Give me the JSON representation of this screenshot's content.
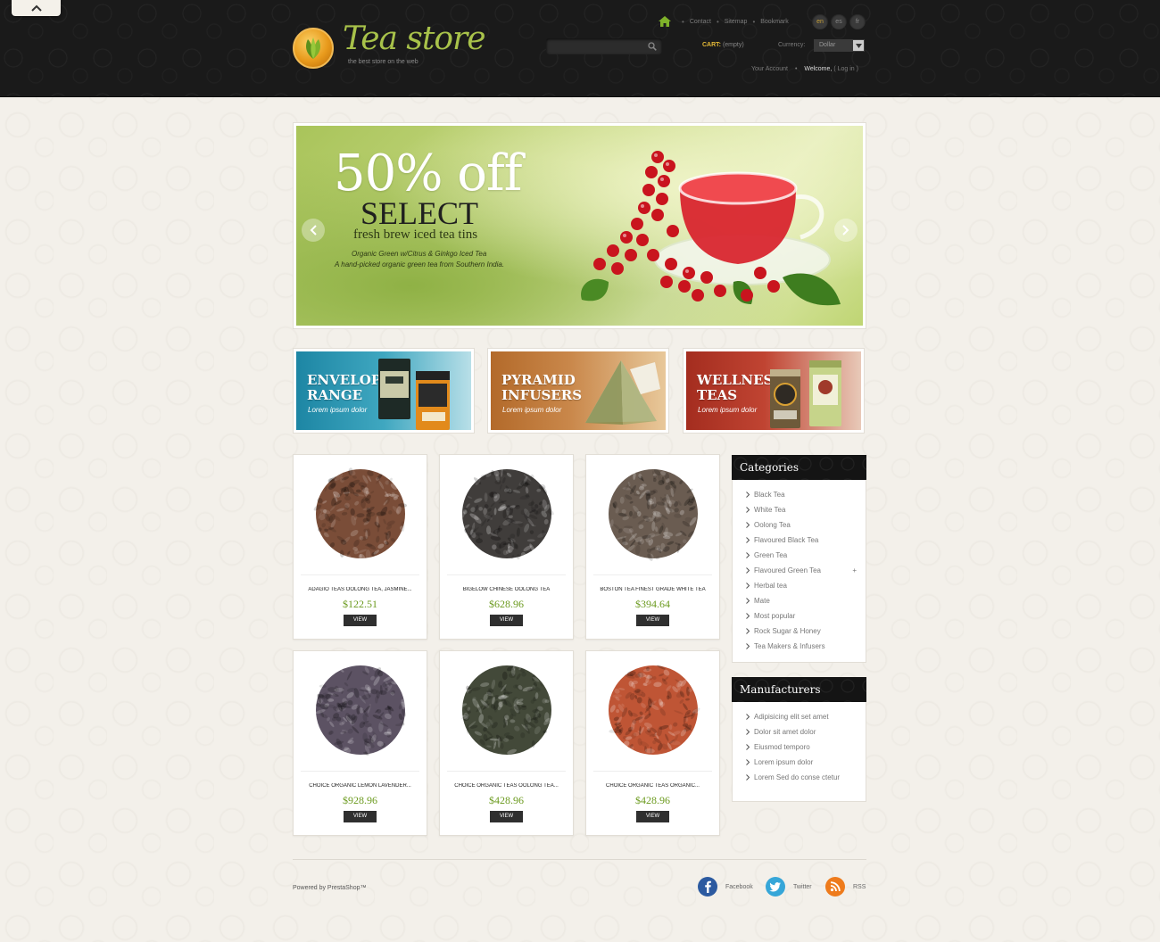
{
  "header": {
    "logo_title": "Tea store",
    "logo_tagline": "the best store on the web",
    "top_links": [
      "Contact",
      "Sitemap",
      "Bookmark"
    ],
    "languages": [
      {
        "code": "en",
        "active": true
      },
      {
        "code": "es",
        "active": false
      },
      {
        "code": "fr",
        "active": false
      }
    ],
    "search_placeholder": "",
    "cart_label": "CART:",
    "cart_status": "(empty)",
    "currency_label": "Currency:",
    "currency_value": "Dollar",
    "account_link": "Your Account",
    "welcome": "Welcome,",
    "login": "( Log in )"
  },
  "slider": {
    "headline": "50% off",
    "subheadline": "SELECT",
    "line": "fresh brew iced tea tins",
    "desc1": "Organic Green w/Citrus & Ginkgo Iced Tea",
    "desc2": "A hand-picked organic green tea from Southern India."
  },
  "banners": [
    {
      "title": "ENVELOPE RANGE",
      "subtitle": "Lorem ipsum  dolor"
    },
    {
      "title": "PYRAMID INFUSERS",
      "subtitle": "Lorem ipsum  dolor"
    },
    {
      "title": "WELLNESS TEAS",
      "subtitle": "Lorem ipsum  dolor"
    }
  ],
  "products": [
    {
      "name": "ADAGIO TEAS OOLONG TEA, JASMINE...",
      "price": "$122.51",
      "button": "VIEW",
      "color": "#6b3a22"
    },
    {
      "name": "BIGELOW CHINESE OOLONG TEA",
      "price": "$628.96",
      "button": "VIEW",
      "color": "#2b2826"
    },
    {
      "name": "BOSTON TEA FINEST GRADE WHITE TEA",
      "price": "$394.64",
      "button": "VIEW",
      "color": "#5a4a3e"
    },
    {
      "name": "CHOICE ORGANIC LEMON LAVENDER...",
      "price": "$928.96",
      "button": "VIEW",
      "color": "#4a3f52"
    },
    {
      "name": "CHOICE ORGANIC TEAS OOLONG TEA...",
      "price": "$428.96",
      "button": "VIEW",
      "color": "#2f3524"
    },
    {
      "name": "CHOICE ORGANIC TEAS ORGANIC...",
      "price": "$428.96",
      "button": "VIEW",
      "color": "#b8421f"
    }
  ],
  "categories": {
    "title": "Categories",
    "items": [
      "Black Tea",
      "White Tea",
      "Oolong Tea",
      "Flavoured Black Tea",
      "Green Tea",
      "Flavoured Green Tea",
      "Herbal tea",
      "Mate",
      "Most popular",
      "Rock Sugar & Honey",
      "Tea Makers & Infusers"
    ],
    "expand_symbol": "+"
  },
  "manufacturers": {
    "title": "Manufacturers",
    "items": [
      "Adipisicing elit set amet",
      "Dolor sit amet dolor",
      "Eiusmod temporo",
      "Lorem ipsum dolor",
      "Lorem Sed do conse ctetur"
    ]
  },
  "footer": {
    "powered": "Powered by PrestaShop™",
    "facebook": "Facebook",
    "twitter": "Twitter",
    "rss": "RSS"
  },
  "colors": {
    "accent_green": "#6b9a1e",
    "cart_gold": "#e4b937",
    "header_bg": "#1a1a1a"
  }
}
